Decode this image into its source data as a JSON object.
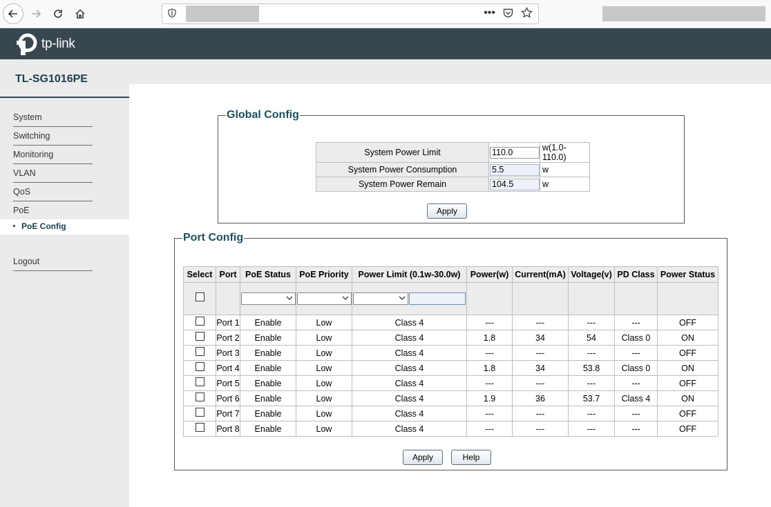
{
  "header": {
    "logo_text": "tp-link"
  },
  "sidebar": {
    "model": "TL-SG1016PE",
    "items": [
      {
        "label": "System"
      },
      {
        "label": "Switching"
      },
      {
        "label": "Monitoring"
      },
      {
        "label": "VLAN"
      },
      {
        "label": "QoS"
      },
      {
        "label": "PoE"
      }
    ],
    "active_subitem": "PoE Config",
    "logout": "Logout"
  },
  "global_config": {
    "title": "Global Config",
    "rows": [
      {
        "label": "System Power Limit",
        "value": "110.0",
        "unit": "w(1.0-110.0)"
      },
      {
        "label": "System Power Consumption",
        "value": "5.5",
        "unit": "w"
      },
      {
        "label": "System Power Remain",
        "value": "104.5",
        "unit": "w"
      }
    ],
    "apply_label": "Apply"
  },
  "port_config": {
    "title": "Port Config",
    "headers": [
      "Select",
      "Port",
      "PoE Status",
      "PoE Priority",
      "Power Limit (0.1w-30.0w)",
      "Power(w)",
      "Current(mA)",
      "Voltage(v)",
      "PD Class",
      "Power Status"
    ],
    "rows": [
      {
        "port": "Port 1",
        "status": "Enable",
        "priority": "Low",
        "limit": "Class 4",
        "power": "---",
        "current": "---",
        "voltage": "---",
        "pd_class": "---",
        "power_status": "OFF"
      },
      {
        "port": "Port 2",
        "status": "Enable",
        "priority": "Low",
        "limit": "Class 4",
        "power": "1.8",
        "current": "34",
        "voltage": "54",
        "pd_class": "Class 0",
        "power_status": "ON"
      },
      {
        "port": "Port 3",
        "status": "Enable",
        "priority": "Low",
        "limit": "Class 4",
        "power": "---",
        "current": "---",
        "voltage": "---",
        "pd_class": "---",
        "power_status": "OFF"
      },
      {
        "port": "Port 4",
        "status": "Enable",
        "priority": "Low",
        "limit": "Class 4",
        "power": "1.8",
        "current": "34",
        "voltage": "53.8",
        "pd_class": "Class 0",
        "power_status": "ON"
      },
      {
        "port": "Port 5",
        "status": "Enable",
        "priority": "Low",
        "limit": "Class 4",
        "power": "---",
        "current": "---",
        "voltage": "---",
        "pd_class": "---",
        "power_status": "OFF"
      },
      {
        "port": "Port 6",
        "status": "Enable",
        "priority": "Low",
        "limit": "Class 4",
        "power": "1.9",
        "current": "36",
        "voltage": "53.7",
        "pd_class": "Class 4",
        "power_status": "ON"
      },
      {
        "port": "Port 7",
        "status": "Enable",
        "priority": "Low",
        "limit": "Class 4",
        "power": "---",
        "current": "---",
        "voltage": "---",
        "pd_class": "---",
        "power_status": "OFF"
      },
      {
        "port": "Port 8",
        "status": "Enable",
        "priority": "Low",
        "limit": "Class 4",
        "power": "---",
        "current": "---",
        "voltage": "---",
        "pd_class": "---",
        "power_status": "OFF"
      }
    ],
    "apply_label": "Apply",
    "help_label": "Help"
  }
}
